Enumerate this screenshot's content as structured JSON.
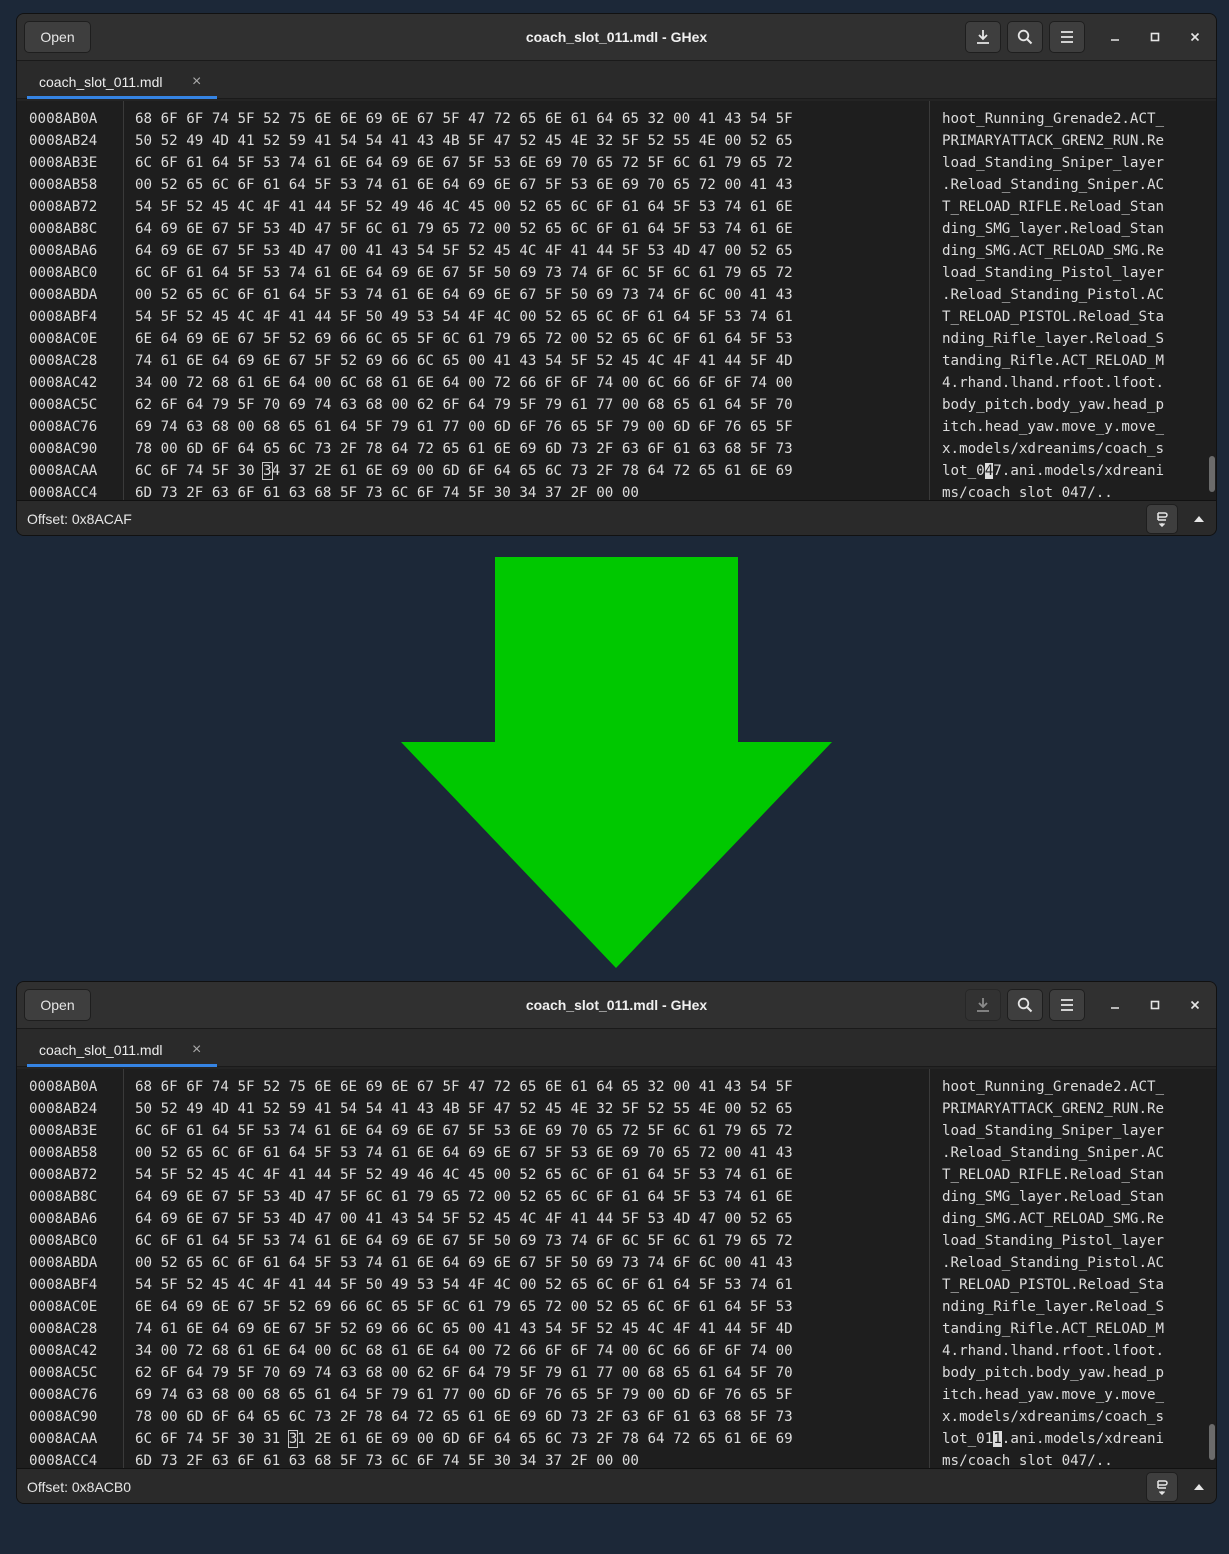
{
  "arrow": {
    "color": "#00c800",
    "icon": "down-arrow-icon"
  },
  "windows": [
    {
      "open_label": "Open",
      "title": "coach_slot_011.mdl - GHex",
      "tab_label": "coach_slot_011.mdl",
      "tab_close": "×",
      "status": "Offset: 0x8ACAF",
      "download_enabled": true,
      "rows": [
        {
          "offset": "0008AB0A",
          "hex": "68 6F 6F 74 5F 52 75 6E 6E 69 6E 67 5F 47 72 65 6E 61 64 65 32 00 41 43 54 5F",
          "ascii": "hoot_Running_Grenade2.ACT_"
        },
        {
          "offset": "0008AB24",
          "hex": "50 52 49 4D 41 52 59 41 54 54 41 43 4B 5F 47 52 45 4E 32 5F 52 55 4E 00 52 65",
          "ascii": "PRIMARYATTACK_GREN2_RUN.Re"
        },
        {
          "offset": "0008AB3E",
          "hex": "6C 6F 61 64 5F 53 74 61 6E 64 69 6E 67 5F 53 6E 69 70 65 72 5F 6C 61 79 65 72",
          "ascii": "load_Standing_Sniper_layer"
        },
        {
          "offset": "0008AB58",
          "hex": "00 52 65 6C 6F 61 64 5F 53 74 61 6E 64 69 6E 67 5F 53 6E 69 70 65 72 00 41 43",
          "ascii": ".Reload_Standing_Sniper.AC"
        },
        {
          "offset": "0008AB72",
          "hex": "54 5F 52 45 4C 4F 41 44 5F 52 49 46 4C 45 00 52 65 6C 6F 61 64 5F 53 74 61 6E",
          "ascii": "T_RELOAD_RIFLE.Reload_Stan"
        },
        {
          "offset": "0008AB8C",
          "hex": "64 69 6E 67 5F 53 4D 47 5F 6C 61 79 65 72 00 52 65 6C 6F 61 64 5F 53 74 61 6E",
          "ascii": "ding_SMG_layer.Reload_Stan"
        },
        {
          "offset": "0008ABA6",
          "hex": "64 69 6E 67 5F 53 4D 47 00 41 43 54 5F 52 45 4C 4F 41 44 5F 53 4D 47 00 52 65",
          "ascii": "ding_SMG.ACT_RELOAD_SMG.Re"
        },
        {
          "offset": "0008ABC0",
          "hex": "6C 6F 61 64 5F 53 74 61 6E 64 69 6E 67 5F 50 69 73 74 6F 6C 5F 6C 61 79 65 72",
          "ascii": "load_Standing_Pistol_layer"
        },
        {
          "offset": "0008ABDA",
          "hex": "00 52 65 6C 6F 61 64 5F 53 74 61 6E 64 69 6E 67 5F 50 69 73 74 6F 6C 00 41 43",
          "ascii": ".Reload_Standing_Pistol.AC"
        },
        {
          "offset": "0008ABF4",
          "hex": "54 5F 52 45 4C 4F 41 44 5F 50 49 53 54 4F 4C 00 52 65 6C 6F 61 64 5F 53 74 61",
          "ascii": "T_RELOAD_PISTOL.Reload_Sta"
        },
        {
          "offset": "0008AC0E",
          "hex": "6E 64 69 6E 67 5F 52 69 66 6C 65 5F 6C 61 79 65 72 00 52 65 6C 6F 61 64 5F 53",
          "ascii": "nding_Rifle_layer.Reload_S"
        },
        {
          "offset": "0008AC28",
          "hex": "74 61 6E 64 69 6E 67 5F 52 69 66 6C 65 00 41 43 54 5F 52 45 4C 4F 41 44 5F 4D",
          "ascii": "tanding_Rifle.ACT_RELOAD_M"
        },
        {
          "offset": "0008AC42",
          "hex": "34 00 72 68 61 6E 64 00 6C 68 61 6E 64 00 72 66 6F 6F 74 00 6C 66 6F 6F 74 00",
          "ascii": "4.rhand.lhand.rfoot.lfoot."
        },
        {
          "offset": "0008AC5C",
          "hex": "62 6F 64 79 5F 70 69 74 63 68 00 62 6F 64 79 5F 79 61 77 00 68 65 61 64 5F 70",
          "ascii": "body_pitch.body_yaw.head_p"
        },
        {
          "offset": "0008AC76",
          "hex": "69 74 63 68 00 68 65 61 64 5F 79 61 77 00 6D 6F 76 65 5F 79 00 6D 6F 76 65 5F",
          "ascii": "itch.head_yaw.move_y.move_"
        },
        {
          "offset": "0008AC90",
          "hex": "78 00 6D 6F 64 65 6C 73 2F 78 64 72 65 61 6E 69 6D 73 2F 63 6F 61 63 68 5F 73",
          "ascii": "x.models/xdreanims/coach_s"
        },
        {
          "offset": "0008ACAA",
          "hex": "6C 6F 74 5F 30 34 37 2E 61 6E 69 00 6D 6F 64 65 6C 73 2F 78 64 72 65 61 6E 69",
          "ascii": "lot_047.ani.models/xdreani"
        },
        {
          "offset": "0008ACC4",
          "hex": "6D 73 2F 63 6F 61 63 68 5F 73 6C 6F 74 5F 30 34 37 2F 00 00",
          "ascii": "ms/coach_slot_047/.."
        }
      ]
    },
    {
      "open_label": "Open",
      "title": "coach_slot_011.mdl - GHex",
      "tab_label": "coach_slot_011.mdl",
      "tab_close": "×",
      "status": "Offset: 0x8ACB0",
      "download_enabled": false,
      "rows": [
        {
          "offset": "0008AB0A",
          "hex": "68 6F 6F 74 5F 52 75 6E 6E 69 6E 67 5F 47 72 65 6E 61 64 65 32 00 41 43 54 5F",
          "ascii": "hoot_Running_Grenade2.ACT_"
        },
        {
          "offset": "0008AB24",
          "hex": "50 52 49 4D 41 52 59 41 54 54 41 43 4B 5F 47 52 45 4E 32 5F 52 55 4E 00 52 65",
          "ascii": "PRIMARYATTACK_GREN2_RUN.Re"
        },
        {
          "offset": "0008AB3E",
          "hex": "6C 6F 61 64 5F 53 74 61 6E 64 69 6E 67 5F 53 6E 69 70 65 72 5F 6C 61 79 65 72",
          "ascii": "load_Standing_Sniper_layer"
        },
        {
          "offset": "0008AB58",
          "hex": "00 52 65 6C 6F 61 64 5F 53 74 61 6E 64 69 6E 67 5F 53 6E 69 70 65 72 00 41 43",
          "ascii": ".Reload_Standing_Sniper.AC"
        },
        {
          "offset": "0008AB72",
          "hex": "54 5F 52 45 4C 4F 41 44 5F 52 49 46 4C 45 00 52 65 6C 6F 61 64 5F 53 74 61 6E",
          "ascii": "T_RELOAD_RIFLE.Reload_Stan"
        },
        {
          "offset": "0008AB8C",
          "hex": "64 69 6E 67 5F 53 4D 47 5F 6C 61 79 65 72 00 52 65 6C 6F 61 64 5F 53 74 61 6E",
          "ascii": "ding_SMG_layer.Reload_Stan"
        },
        {
          "offset": "0008ABA6",
          "hex": "64 69 6E 67 5F 53 4D 47 00 41 43 54 5F 52 45 4C 4F 41 44 5F 53 4D 47 00 52 65",
          "ascii": "ding_SMG.ACT_RELOAD_SMG.Re"
        },
        {
          "offset": "0008ABC0",
          "hex": "6C 6F 61 64 5F 53 74 61 6E 64 69 6E 67 5F 50 69 73 74 6F 6C 5F 6C 61 79 65 72",
          "ascii": "load_Standing_Pistol_layer"
        },
        {
          "offset": "0008ABDA",
          "hex": "00 52 65 6C 6F 61 64 5F 53 74 61 6E 64 69 6E 67 5F 50 69 73 74 6F 6C 00 41 43",
          "ascii": ".Reload_Standing_Pistol.AC"
        },
        {
          "offset": "0008ABF4",
          "hex": "54 5F 52 45 4C 4F 41 44 5F 50 49 53 54 4F 4C 00 52 65 6C 6F 61 64 5F 53 74 61",
          "ascii": "T_RELOAD_PISTOL.Reload_Sta"
        },
        {
          "offset": "0008AC0E",
          "hex": "6E 64 69 6E 67 5F 52 69 66 6C 65 5F 6C 61 79 65 72 00 52 65 6C 6F 61 64 5F 53",
          "ascii": "nding_Rifle_layer.Reload_S"
        },
        {
          "offset": "0008AC28",
          "hex": "74 61 6E 64 69 6E 67 5F 52 69 66 6C 65 00 41 43 54 5F 52 45 4C 4F 41 44 5F 4D",
          "ascii": "tanding_Rifle.ACT_RELOAD_M"
        },
        {
          "offset": "0008AC42",
          "hex": "34 00 72 68 61 6E 64 00 6C 68 61 6E 64 00 72 66 6F 6F 74 00 6C 66 6F 6F 74 00",
          "ascii": "4.rhand.lhand.rfoot.lfoot."
        },
        {
          "offset": "0008AC5C",
          "hex": "62 6F 64 79 5F 70 69 74 63 68 00 62 6F 64 79 5F 79 61 77 00 68 65 61 64 5F 70",
          "ascii": "body_pitch.body_yaw.head_p"
        },
        {
          "offset": "0008AC76",
          "hex": "69 74 63 68 00 68 65 61 64 5F 79 61 77 00 6D 6F 76 65 5F 79 00 6D 6F 76 65 5F",
          "ascii": "itch.head_yaw.move_y.move_"
        },
        {
          "offset": "0008AC90",
          "hex": "78 00 6D 6F 64 65 6C 73 2F 78 64 72 65 61 6E 69 6D 73 2F 63 6F 61 63 68 5F 73",
          "ascii": "x.models/xdreanims/coach_s"
        },
        {
          "offset": "0008ACAA",
          "hex": "6C 6F 74 5F 30 31 31 2E 61 6E 69 00 6D 6F 64 65 6C 73 2F 78 64 72 65 61 6E 69",
          "ascii": "lot_011.ani.models/xdreani"
        },
        {
          "offset": "0008ACC4",
          "hex": "6D 73 2F 63 6F 61 63 68 5F 73 6C 6F 74 5F 30 34 37 2F 00 00",
          "ascii": "ms/coach_slot_047/.."
        }
      ]
    }
  ]
}
